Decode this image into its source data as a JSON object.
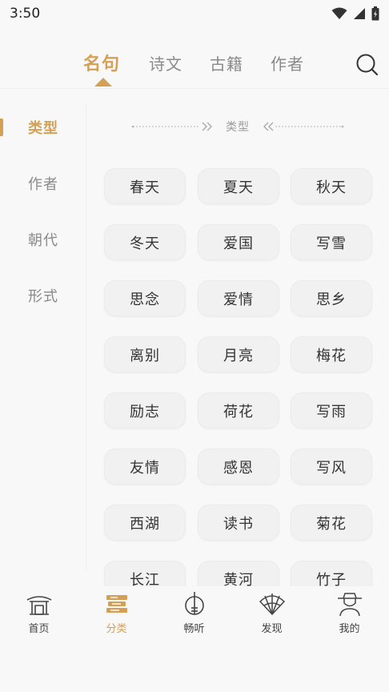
{
  "status_bar": {
    "time": "3:50"
  },
  "top_tabs": [
    {
      "label": "名句",
      "active": true
    },
    {
      "label": "诗文",
      "active": false
    },
    {
      "label": "古籍",
      "active": false
    },
    {
      "label": "作者",
      "active": false
    }
  ],
  "sidebar": {
    "items": [
      {
        "label": "类型",
        "active": true
      },
      {
        "label": "作者",
        "active": false
      },
      {
        "label": "朝代",
        "active": false
      },
      {
        "label": "形式",
        "active": false
      }
    ]
  },
  "content": {
    "section_title": "类型",
    "tags": [
      "春天",
      "夏天",
      "秋天",
      "冬天",
      "爱国",
      "写雪",
      "思念",
      "爱情",
      "思乡",
      "离别",
      "月亮",
      "梅花",
      "励志",
      "荷花",
      "写雨",
      "友情",
      "感恩",
      "写风",
      "西湖",
      "读书",
      "菊花",
      "长江",
      "黄河",
      "竹子"
    ]
  },
  "bottom_nav": [
    {
      "label": "首页",
      "icon": "temple-icon",
      "active": false
    },
    {
      "label": "分类",
      "icon": "books-icon",
      "active": true
    },
    {
      "label": "畅听",
      "icon": "guqin-icon",
      "active": false
    },
    {
      "label": "发现",
      "icon": "fan-icon",
      "active": false
    },
    {
      "label": "我的",
      "icon": "scholar-icon",
      "active": false
    }
  ],
  "colors": {
    "accent": "#d4a055",
    "text": "#333333",
    "muted": "#8a8a8a",
    "background": "#f8f8f8",
    "tag_background": "#f1f1f1"
  }
}
